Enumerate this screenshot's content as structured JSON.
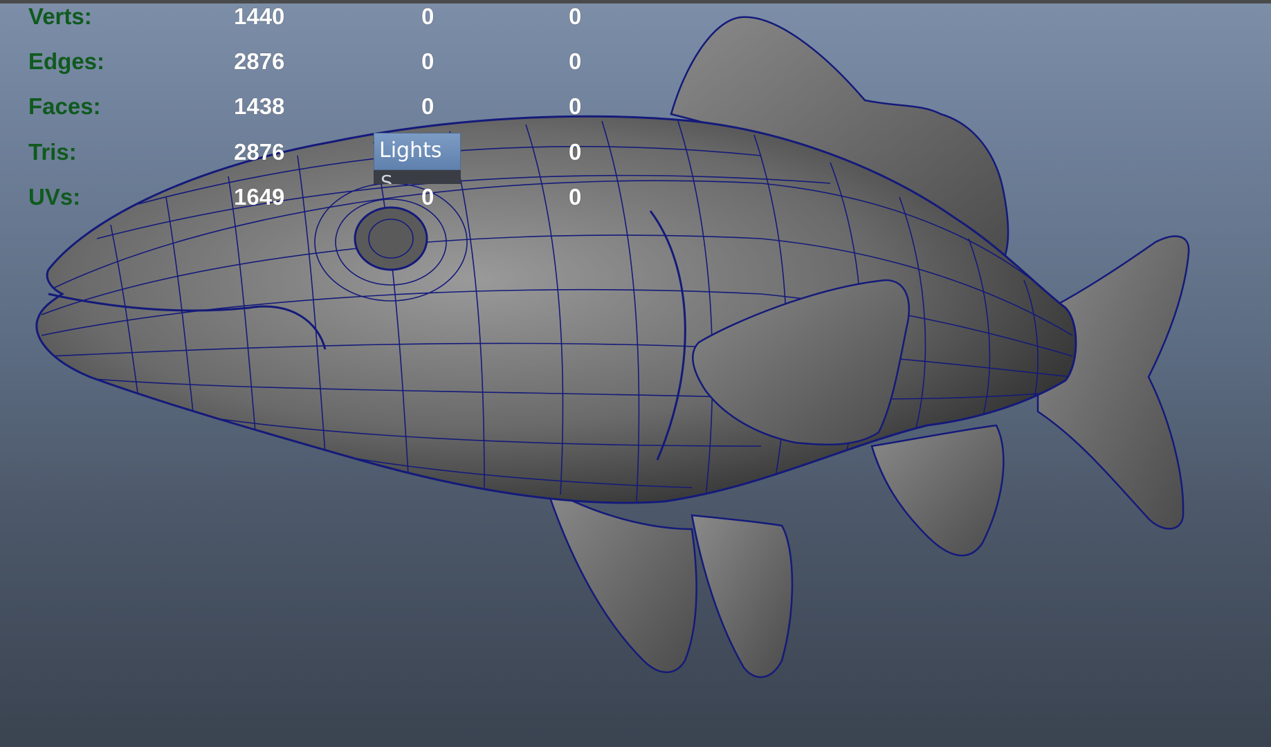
{
  "viewport": {
    "background_top": "#7c8ea8",
    "background_bottom": "#3a4350",
    "wireframe_color": "#141a7a",
    "model_name": "fish-mesh"
  },
  "hud": {
    "rows": [
      {
        "label": "Verts:",
        "v1": "1440",
        "v2": "0",
        "v3": "0"
      },
      {
        "label": "Edges:",
        "v1": "2876",
        "v2": "0",
        "v3": "0"
      },
      {
        "label": "Faces:",
        "v1": "1438",
        "v2": "0",
        "v3": "0"
      },
      {
        "label": "Tris:",
        "v1": "2876",
        "v2": "",
        "v3": "0"
      },
      {
        "label": "UVs:",
        "v1": "1649",
        "v2": "0",
        "v3": "0"
      }
    ],
    "label_color": "#0f5a1e",
    "value_color": "#ffffff"
  },
  "menu": {
    "highlighted_item": "Lights",
    "next_item_partial": "S"
  }
}
